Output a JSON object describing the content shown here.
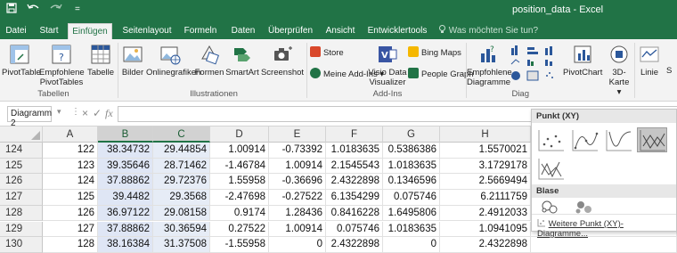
{
  "window": {
    "title": "position_data - Excel"
  },
  "quick_access": {
    "save_icon": "save-icon",
    "undo_icon": "undo-icon",
    "redo_icon": "redo-icon",
    "more": "="
  },
  "menu": {
    "tabs": [
      "Datei",
      "Start",
      "Einfügen",
      "Seitenlayout",
      "Formeln",
      "Daten",
      "Überprüfen",
      "Ansicht",
      "Entwicklertools"
    ],
    "active_tab": "Einfügen",
    "tell_me": "Was möchten Sie tun?"
  },
  "ribbon": {
    "tabellen": {
      "label": "Tabellen",
      "pivot": "PivotTable",
      "recommended_pivot_1": "Empfohlene",
      "recommended_pivot_2": "PivotTables",
      "table": "Tabelle"
    },
    "illustrationen": {
      "label": "Illustrationen",
      "pictures": "Bilder",
      "online_pictures": "Onlinegrafiken",
      "shapes": "Formen",
      "smartart": "SmartArt",
      "screenshot": "Screenshot"
    },
    "addins": {
      "label": "Add-Ins",
      "store": "Store",
      "my_addins": "Meine Add-Ins",
      "visio_1": "Visio Data",
      "visio_2": "Visualizer",
      "bing_maps": "Bing Maps",
      "people_graph": "People Graph"
    },
    "diagramme": {
      "label": "Diag",
      "recommended_1": "Empfohlene",
      "recommended_2": "Diagramme",
      "pivotchart": "PivotChart",
      "map3d_1": "3D-",
      "map3d_2": "Karte",
      "sparkline_line": "Linie",
      "sparkline_extra": "S"
    }
  },
  "formula_bar": {
    "name_box": "Diagramm 2",
    "cancel": "×",
    "confirm": "✓",
    "fx": "fx",
    "value": ""
  },
  "sheet": {
    "columns": [
      "A",
      "B",
      "C",
      "D",
      "E",
      "F",
      "G",
      "H"
    ],
    "rows": [
      {
        "num": "124",
        "cells": [
          "122",
          "38.34732",
          "29.44854",
          "1.00914",
          "-0.73392",
          "1.0183635",
          "0.5386386",
          "1.5570021"
        ]
      },
      {
        "num": "125",
        "cells": [
          "123",
          "39.35646",
          "28.71462",
          "-1.46784",
          "1.00914",
          "2.1545543",
          "1.0183635",
          "3.1729178"
        ]
      },
      {
        "num": "126",
        "cells": [
          "124",
          "37.88862",
          "29.72376",
          "1.55958",
          "-0.36696",
          "2.4322898",
          "0.1346596",
          "2.5669494"
        ]
      },
      {
        "num": "127",
        "cells": [
          "125",
          "39.4482",
          "29.3568",
          "-2.47698",
          "-0.27522",
          "6.1354299",
          "0.075746",
          "6.2111759"
        ]
      },
      {
        "num": "128",
        "cells": [
          "126",
          "36.97122",
          "29.08158",
          "0.9174",
          "1.28436",
          "0.8416228",
          "1.6495806",
          "2.4912033"
        ]
      },
      {
        "num": "129",
        "cells": [
          "127",
          "37.88862",
          "30.36594",
          "0.27522",
          "1.00914",
          "0.075746",
          "1.0183635",
          "1.0941095"
        ]
      },
      {
        "num": "130",
        "cells": [
          "128",
          "38.16384",
          "31.37508",
          "-1.55958",
          "0",
          "2.4322898",
          "0",
          "2.4322898"
        ]
      }
    ]
  },
  "scatter_dropdown": {
    "section_xy": "Punkt (XY)",
    "section_bubble": "Blase",
    "more_link": "Weitere Punkt (XY)-Diagramme..."
  },
  "colors": {
    "excel_green": "#217346",
    "ribbon_bg": "#f3f3f3",
    "selection_blue": "#dfe6f5"
  }
}
